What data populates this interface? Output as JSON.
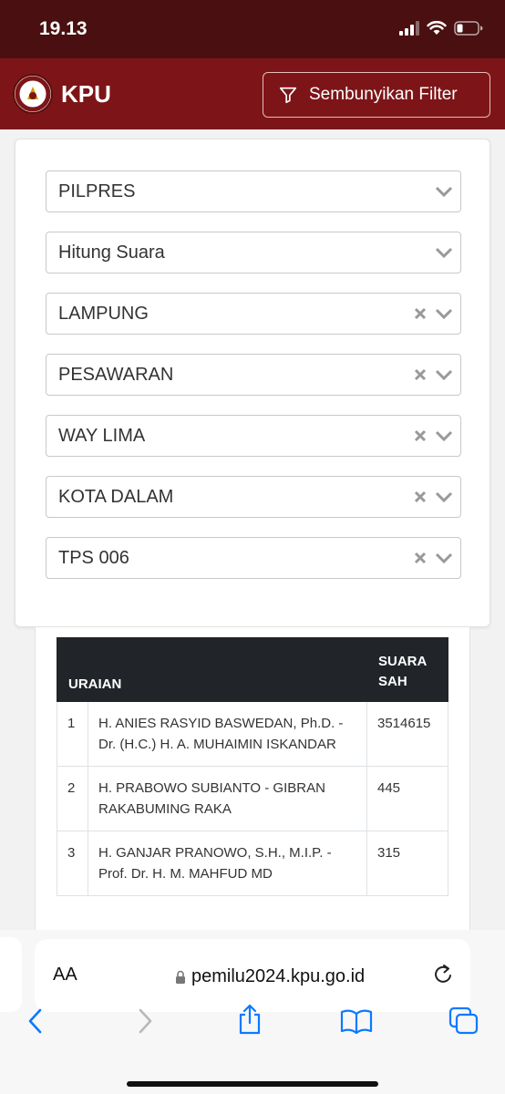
{
  "status_bar": {
    "time": "19.13"
  },
  "header": {
    "brand": "KPU",
    "filter_button_label": "Sembunyikan Filter"
  },
  "filters": [
    {
      "value": "PILPRES",
      "clearable": false
    },
    {
      "value": "Hitung Suara",
      "clearable": false
    },
    {
      "value": "LAMPUNG",
      "clearable": true
    },
    {
      "value": "PESAWARAN",
      "clearable": true
    },
    {
      "value": "WAY LIMA",
      "clearable": true
    },
    {
      "value": "KOTA DALAM",
      "clearable": true
    },
    {
      "value": "TPS 006",
      "clearable": true
    }
  ],
  "table": {
    "headers": {
      "uraian": "URAIAN",
      "suara_line1": "SUARA",
      "suara_line2": "SAH"
    },
    "rows": [
      {
        "no": "1",
        "name": "H. ANIES RASYID BASWEDAN, Ph.D. - Dr. (H.C.) H. A. MUHAIMIN ISKANDAR",
        "votes": "3514615"
      },
      {
        "no": "2",
        "name": "H. PRABOWO SUBIANTO - GIBRAN RAKABUMING RAKA",
        "votes": "445"
      },
      {
        "no": "3",
        "name": "H. GANJAR PRANOWO, S.H., M.I.P. - Prof. Dr. H. M. MAHFUD MD",
        "votes": "315"
      }
    ]
  },
  "browser": {
    "aa_label": "AA",
    "url": "pemilu2024.kpu.go.id"
  },
  "icons": {
    "header": [
      "kpu-logo",
      "filter-icon"
    ],
    "select": [
      "clear-icon",
      "chevron-down-icon"
    ],
    "browser": [
      "lock-icon",
      "reload-icon",
      "back-icon",
      "forward-icon",
      "share-icon",
      "bookmarks-icon",
      "tabs-icon"
    ]
  },
  "colors": {
    "status_bar": "#4a0f10",
    "header": "#7d1518",
    "table_header": "#212529",
    "browser_accent": "#0a7aff"
  }
}
